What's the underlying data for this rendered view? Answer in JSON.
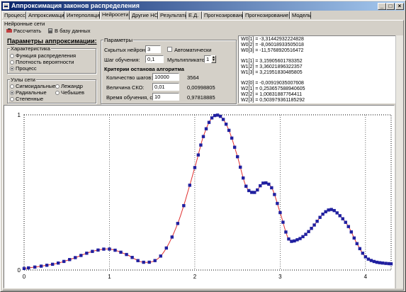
{
  "window": {
    "title": "Аппроксимация законов распределения",
    "controls": [
      "_",
      "□",
      "×"
    ]
  },
  "tabs": [
    "Процесс",
    "Аппроксимация",
    "Интерполяция",
    "Нейросети",
    "Другие НС",
    "Результаты",
    "Е.Д.",
    "Прогнозирование",
    "Прогнозирование 2",
    "Модель"
  ],
  "active_tab": "Нейросети",
  "subtab": "Нейронные сети",
  "toolbar": {
    "calc_label": "Рассчитать",
    "db_label": "В базу данных"
  },
  "params_heading": "Параметры аппроксимации:",
  "characteristic": {
    "title": "Характеристика",
    "options": [
      "Функция распределения",
      "Плотность вероятности",
      "Процесс"
    ],
    "selected": "Процесс"
  },
  "net_nodes": {
    "title": "Узлы сети",
    "options": [
      "Сигмоидальные",
      "Лежандр",
      "Радиальные",
      "Чебышев",
      "Степенные"
    ],
    "selected": "Радиальные"
  },
  "parameters": {
    "title": "Параметры",
    "hidden_label": "Скрытых нейронов:",
    "hidden_value": "3",
    "auto_label": "Автоматически",
    "step_label": "Шаг обучения:",
    "step_value": "0,1",
    "mult_label": "Мультипликатор:",
    "mult_value": "1"
  },
  "stop_criteria": {
    "title": "Критерии останова алгоритма",
    "steps_label": "Количество шагов:",
    "steps_value": "10000",
    "steps_actual": "3564",
    "sko_label": "Величина СКО:",
    "sko_value": "0,01",
    "sko_actual": "0,00998805",
    "time_label": "Время обучения, с:",
    "time_value": "10",
    "time_actual": "0,97818885"
  },
  "weights": [
    "W0[1] = -3,31442932224828",
    "W0[2] = -8,06018933505018",
    "W0[3] = -11,5768920516472",
    "",
    "W1[1] = 3,15905601783352",
    "W1[2] = 3,36021896322357",
    "W1[3] = 3,21951830485805",
    "",
    "W2[0] = -0,00919035007608",
    "W2[1] = 0,253657588940605",
    "W2[2] = 1,00831887764411",
    "W2[3] = 0,503979361185292"
  ],
  "colors": {
    "marker": "#2020a0",
    "curve": "#e03030"
  },
  "chart_data": {
    "type": "scatter",
    "xlim": [
      0,
      4.3
    ],
    "ylim": [
      0,
      1
    ],
    "x_ticks": [
      "0",
      "1",
      "2",
      "3",
      "4"
    ],
    "y_ticks": [
      "0",
      "1"
    ],
    "grid": "dotted",
    "series": [
      {
        "role": "markers",
        "x": [
          0,
          0.2,
          0.4,
          0.6,
          0.8,
          1.0,
          1.2,
          1.4,
          1.6,
          1.8,
          2.0,
          2.1,
          2.2,
          2.3,
          2.4,
          2.5,
          2.6,
          2.7,
          2.8,
          2.9,
          3.0,
          3.1,
          3.2,
          3.3,
          3.4,
          3.5,
          3.6,
          3.7,
          3.8,
          3.9,
          4.0,
          4.1,
          4.2,
          4.3
        ],
        "y": [
          0.01,
          0.025,
          0.045,
          0.08,
          0.12,
          0.135,
          0.1,
          0.05,
          0.09,
          0.3,
          0.66,
          0.86,
          0.98,
          0.99,
          0.9,
          0.73,
          0.54,
          0.5,
          0.56,
          0.53,
          0.37,
          0.2,
          0.195,
          0.23,
          0.29,
          0.36,
          0.39,
          0.35,
          0.28,
          0.17,
          0.085,
          0.055,
          0.045,
          0.04
        ]
      },
      {
        "role": "curve",
        "x": [
          0,
          0.2,
          0.4,
          0.6,
          0.8,
          1.0,
          1.2,
          1.4,
          1.6,
          1.8,
          2.0,
          2.1,
          2.2,
          2.3,
          2.4,
          2.5,
          2.6,
          2.7,
          2.8,
          2.9,
          3.0,
          3.1,
          3.2,
          3.3,
          3.4,
          3.5,
          3.6,
          3.7,
          3.8,
          3.9,
          4.0,
          4.1,
          4.2,
          4.3
        ],
        "y": [
          0.01,
          0.025,
          0.045,
          0.08,
          0.12,
          0.135,
          0.1,
          0.05,
          0.09,
          0.3,
          0.66,
          0.86,
          0.98,
          0.99,
          0.9,
          0.73,
          0.54,
          0.5,
          0.56,
          0.53,
          0.37,
          0.2,
          0.195,
          0.23,
          0.29,
          0.36,
          0.39,
          0.35,
          0.28,
          0.17,
          0.085,
          0.055,
          0.045,
          0.04
        ]
      }
    ]
  }
}
